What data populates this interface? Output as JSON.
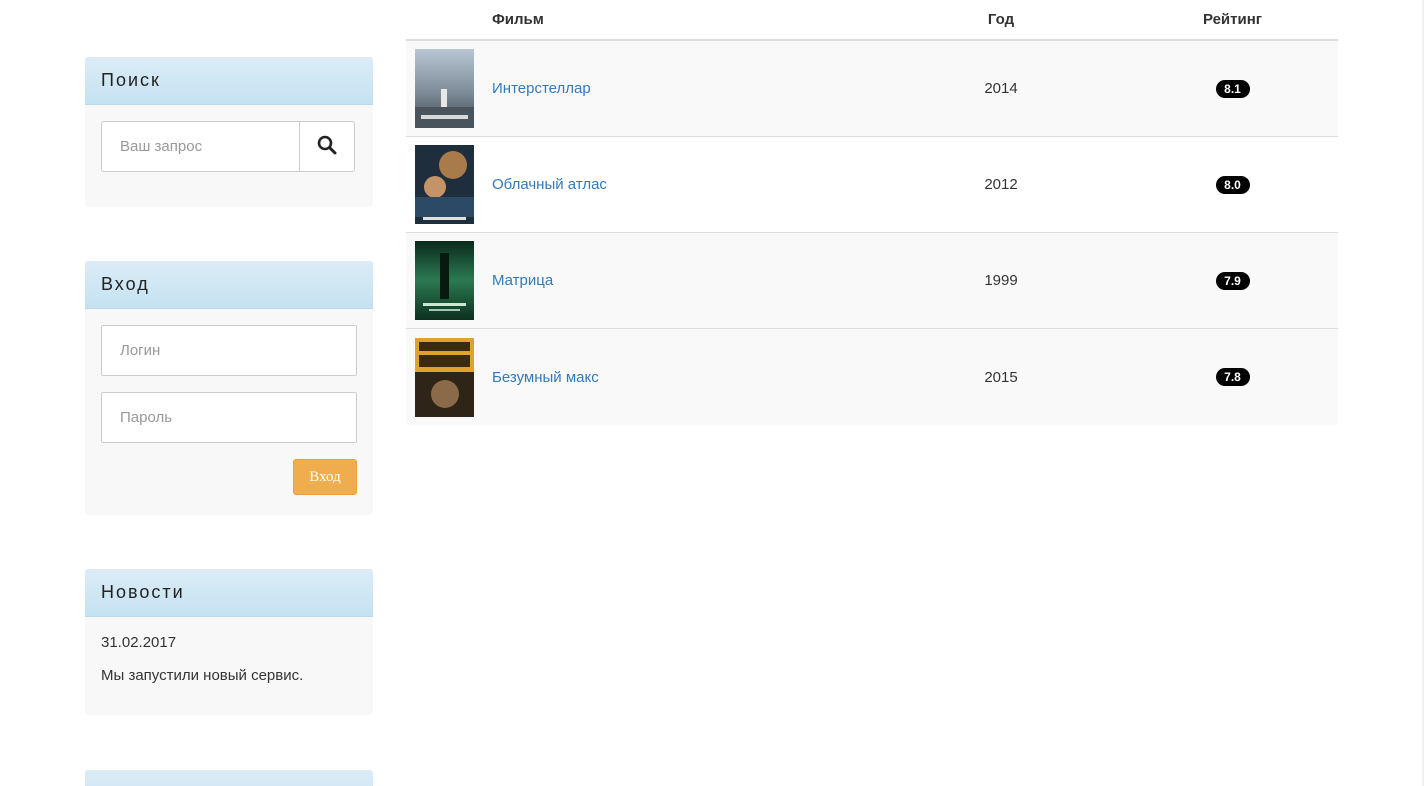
{
  "sidebar": {
    "search": {
      "title": "Поиск",
      "placeholder": "Ваш запрос",
      "button_icon": "search-icon"
    },
    "login": {
      "title": "Вход",
      "login_placeholder": "Логин",
      "password_placeholder": "Пароль",
      "submit_label": "Вход",
      "submit_color": "#f0ad4e"
    },
    "news": {
      "title": "Новости",
      "date": "31.02.2017",
      "text": "Мы запустили новый сервис."
    }
  },
  "films": {
    "headers": {
      "film": "Фильм",
      "year": "Год",
      "rating": "Рейтинг"
    },
    "rows": [
      {
        "title": "Интерстеллар",
        "year": "2014",
        "rating": "8.1",
        "poster_colors": [
          "#9fb3c4",
          "#5e6e7a"
        ]
      },
      {
        "title": "Облачный атлас",
        "year": "2012",
        "rating": "8.0",
        "poster_colors": [
          "#1d2d3c",
          "#a97a4a"
        ]
      },
      {
        "title": "Матрица",
        "year": "1999",
        "rating": "7.9",
        "poster_colors": [
          "#0f3a26",
          "#2e8a5a"
        ]
      },
      {
        "title": "Безумный макс",
        "year": "2015",
        "rating": "7.8",
        "poster_colors": [
          "#e0a22a",
          "#3a2a18"
        ]
      }
    ],
    "link_color": "#337ab7"
  }
}
